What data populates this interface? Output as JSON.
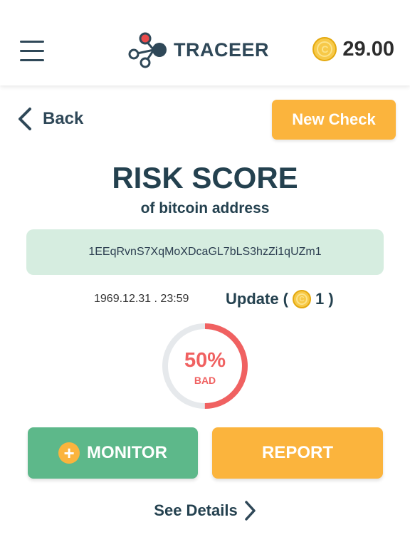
{
  "header": {
    "logo_text": "TRACEER",
    "balance": "29.00",
    "colors": {
      "logo_dot": "#e94b4b",
      "logo_nodes": "#2f4858"
    }
  },
  "nav": {
    "back_label": "Back",
    "new_check_label": "New Check"
  },
  "main": {
    "title": "RISK SCORE",
    "subtitle": "of bitcoin address",
    "address": "1EEqRvnS7XqMoXDcaGL7bLS3hzZi1qUZm1",
    "timestamp": "1969.12.31 . 23:59",
    "update_label": "Update (",
    "update_cost": "1 )"
  },
  "score": {
    "value": "50%",
    "level": 0.5,
    "label": "BAD",
    "color": "#f06161",
    "track_color": "#e6e9ec"
  },
  "actions": {
    "monitor_label": "MONITOR",
    "report_label": "REPORT",
    "see_details_label": "See Details"
  },
  "colors": {
    "accent_orange": "#fbb43d",
    "accent_green": "#5db88a",
    "address_bg": "#d6ede0"
  },
  "icons": [
    "menu-icon",
    "traceer-logo-icon",
    "coin-icon",
    "chevron-left-icon",
    "plus-icon",
    "chevron-right-icon"
  ]
}
